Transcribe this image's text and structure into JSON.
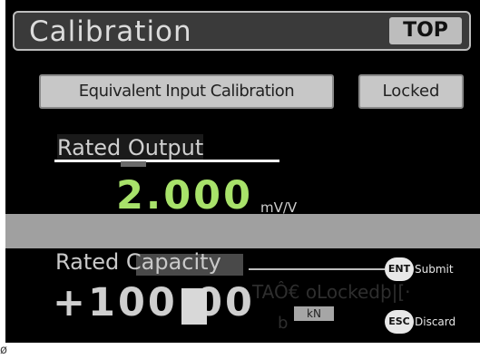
{
  "header": {
    "title": "Calibration",
    "top_button": "TOP"
  },
  "modes": {
    "equivalent_input": "Equivalent Input Calibration",
    "locked": "Locked"
  },
  "rated_output": {
    "label": "Rated Output",
    "value": "2.000",
    "unit": "mV/V"
  },
  "rated_capacity": {
    "label": "Rated Capacity",
    "value": "+100.00",
    "unit": "kN"
  },
  "keys": {
    "ent": "ENT",
    "ent_label": "Submit",
    "esc": "ESC",
    "esc_label": "Discard"
  },
  "overlay_text": {
    "garbled": "TAÔ€ oLockedþ|[·",
    "b": "b"
  },
  "stray": "ø",
  "colors": {
    "accent_value": "#a8e26a",
    "background": "#000000",
    "button_face": "#c7c7c7",
    "band": "#a0a0a0"
  }
}
